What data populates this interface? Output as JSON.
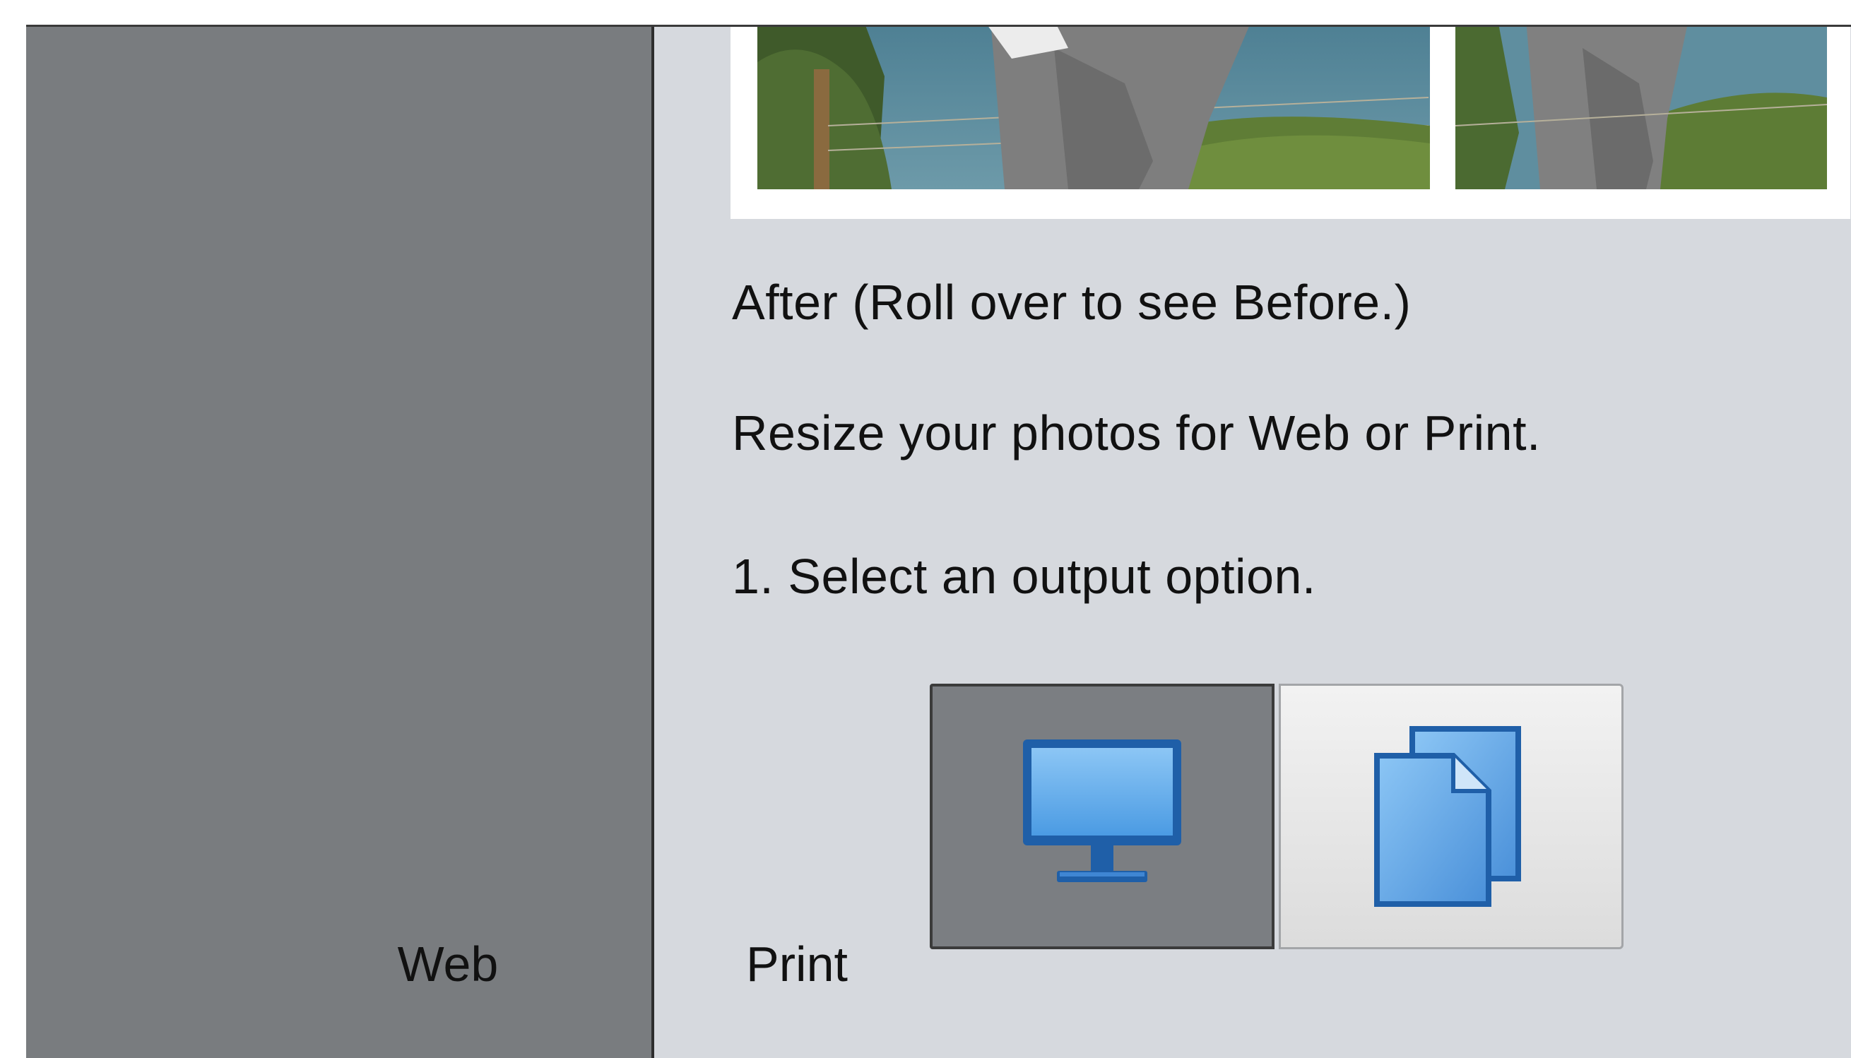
{
  "preview": {
    "caption": "After (Roll over to see Before.)"
  },
  "instructions": {
    "intro": "Resize your photos for Web or Print.",
    "step1": "1. Select an output option."
  },
  "output_options": {
    "selected": "Web",
    "web_label": "Web",
    "print_label": "Print",
    "web_icon": "monitor-icon",
    "print_icon": "documents-icon"
  },
  "colors": {
    "left_panel": "#797c7f",
    "right_panel": "#d6d9de",
    "selected_button": "#7b7e82",
    "icon_blue": "#4a90d9"
  }
}
